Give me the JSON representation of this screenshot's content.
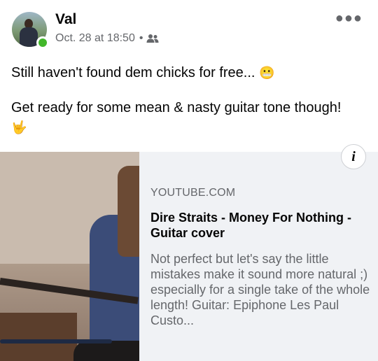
{
  "post": {
    "author": "Val",
    "timestamp": "Oct. 28 at 18:50",
    "separator": "•",
    "audience_icon": "friends-icon",
    "more_icon": "more-options-icon",
    "text_line1": "Still haven't found dem chicks for free... ",
    "emoji1": "😬",
    "text_line2": "Get ready for some mean & nasty guitar tone though!",
    "emoji2": "🤟"
  },
  "link_preview": {
    "source": "YOUTUBE.COM",
    "title": "Dire Straits - Money For Nothing - Guitar cover",
    "description": "Not perfect but let's say the little mistakes make it sound more natural ;) especially for a single take of the whole length! Guitar: Epiphone Les Paul Custo...",
    "info_label": "i"
  },
  "colors": {
    "online": "#42b72a",
    "card_background": "#f0f2f5",
    "secondary_text": "#65676b",
    "primary_text": "#050505"
  }
}
